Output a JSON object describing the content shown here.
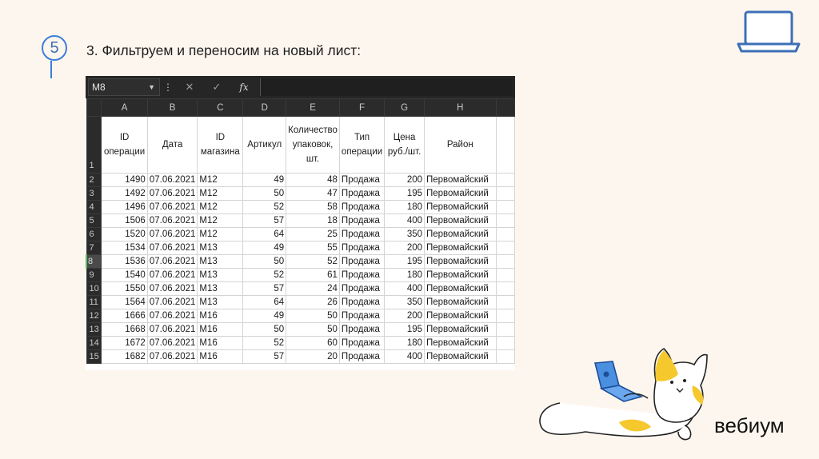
{
  "slide": {
    "step_number": "5",
    "title": "3. Фильтруем и переносим на новый лист:",
    "brand": "вебиум"
  },
  "excel": {
    "name_box": "M8",
    "columns": [
      "A",
      "B",
      "C",
      "D",
      "E",
      "F",
      "G",
      "H",
      ""
    ],
    "header_row_number": "1",
    "headers": [
      "ID операции",
      "Дата",
      "ID магазина",
      "Артикул",
      "Количество упаковок, шт.",
      "Тип операции",
      "Цена руб./шт.",
      "Район",
      ""
    ],
    "selected_row": "8",
    "rows": [
      {
        "n": "2",
        "id": "1490",
        "date": "07.06.2021",
        "store": "М12",
        "art": "49",
        "qty": "48",
        "type": "Продажа",
        "price": "200",
        "region": "Первомайский"
      },
      {
        "n": "3",
        "id": "1492",
        "date": "07.06.2021",
        "store": "М12",
        "art": "50",
        "qty": "47",
        "type": "Продажа",
        "price": "195",
        "region": "Первомайский"
      },
      {
        "n": "4",
        "id": "1496",
        "date": "07.06.2021",
        "store": "М12",
        "art": "52",
        "qty": "58",
        "type": "Продажа",
        "price": "180",
        "region": "Первомайский"
      },
      {
        "n": "5",
        "id": "1506",
        "date": "07.06.2021",
        "store": "М12",
        "art": "57",
        "qty": "18",
        "type": "Продажа",
        "price": "400",
        "region": "Первомайский"
      },
      {
        "n": "6",
        "id": "1520",
        "date": "07.06.2021",
        "store": "М12",
        "art": "64",
        "qty": "25",
        "type": "Продажа",
        "price": "350",
        "region": "Первомайский"
      },
      {
        "n": "7",
        "id": "1534",
        "date": "07.06.2021",
        "store": "М13",
        "art": "49",
        "qty": "55",
        "type": "Продажа",
        "price": "200",
        "region": "Первомайский"
      },
      {
        "n": "8",
        "id": "1536",
        "date": "07.06.2021",
        "store": "М13",
        "art": "50",
        "qty": "52",
        "type": "Продажа",
        "price": "195",
        "region": "Первомайский"
      },
      {
        "n": "9",
        "id": "1540",
        "date": "07.06.2021",
        "store": "М13",
        "art": "52",
        "qty": "61",
        "type": "Продажа",
        "price": "180",
        "region": "Первомайский"
      },
      {
        "n": "10",
        "id": "1550",
        "date": "07.06.2021",
        "store": "М13",
        "art": "57",
        "qty": "24",
        "type": "Продажа",
        "price": "400",
        "region": "Первомайский"
      },
      {
        "n": "11",
        "id": "1564",
        "date": "07.06.2021",
        "store": "М13",
        "art": "64",
        "qty": "26",
        "type": "Продажа",
        "price": "350",
        "region": "Первомайский"
      },
      {
        "n": "12",
        "id": "1666",
        "date": "07.06.2021",
        "store": "М16",
        "art": "49",
        "qty": "50",
        "type": "Продажа",
        "price": "200",
        "region": "Первомайский"
      },
      {
        "n": "13",
        "id": "1668",
        "date": "07.06.2021",
        "store": "М16",
        "art": "50",
        "qty": "50",
        "type": "Продажа",
        "price": "195",
        "region": "Первомайский"
      },
      {
        "n": "14",
        "id": "1672",
        "date": "07.06.2021",
        "store": "М16",
        "art": "52",
        "qty": "60",
        "type": "Продажа",
        "price": "180",
        "region": "Первомайский"
      },
      {
        "n": "15",
        "id": "1682",
        "date": "07.06.2021",
        "store": "М16",
        "art": "57",
        "qty": "20",
        "type": "Продажа",
        "price": "400",
        "region": "Первомайский"
      }
    ]
  }
}
